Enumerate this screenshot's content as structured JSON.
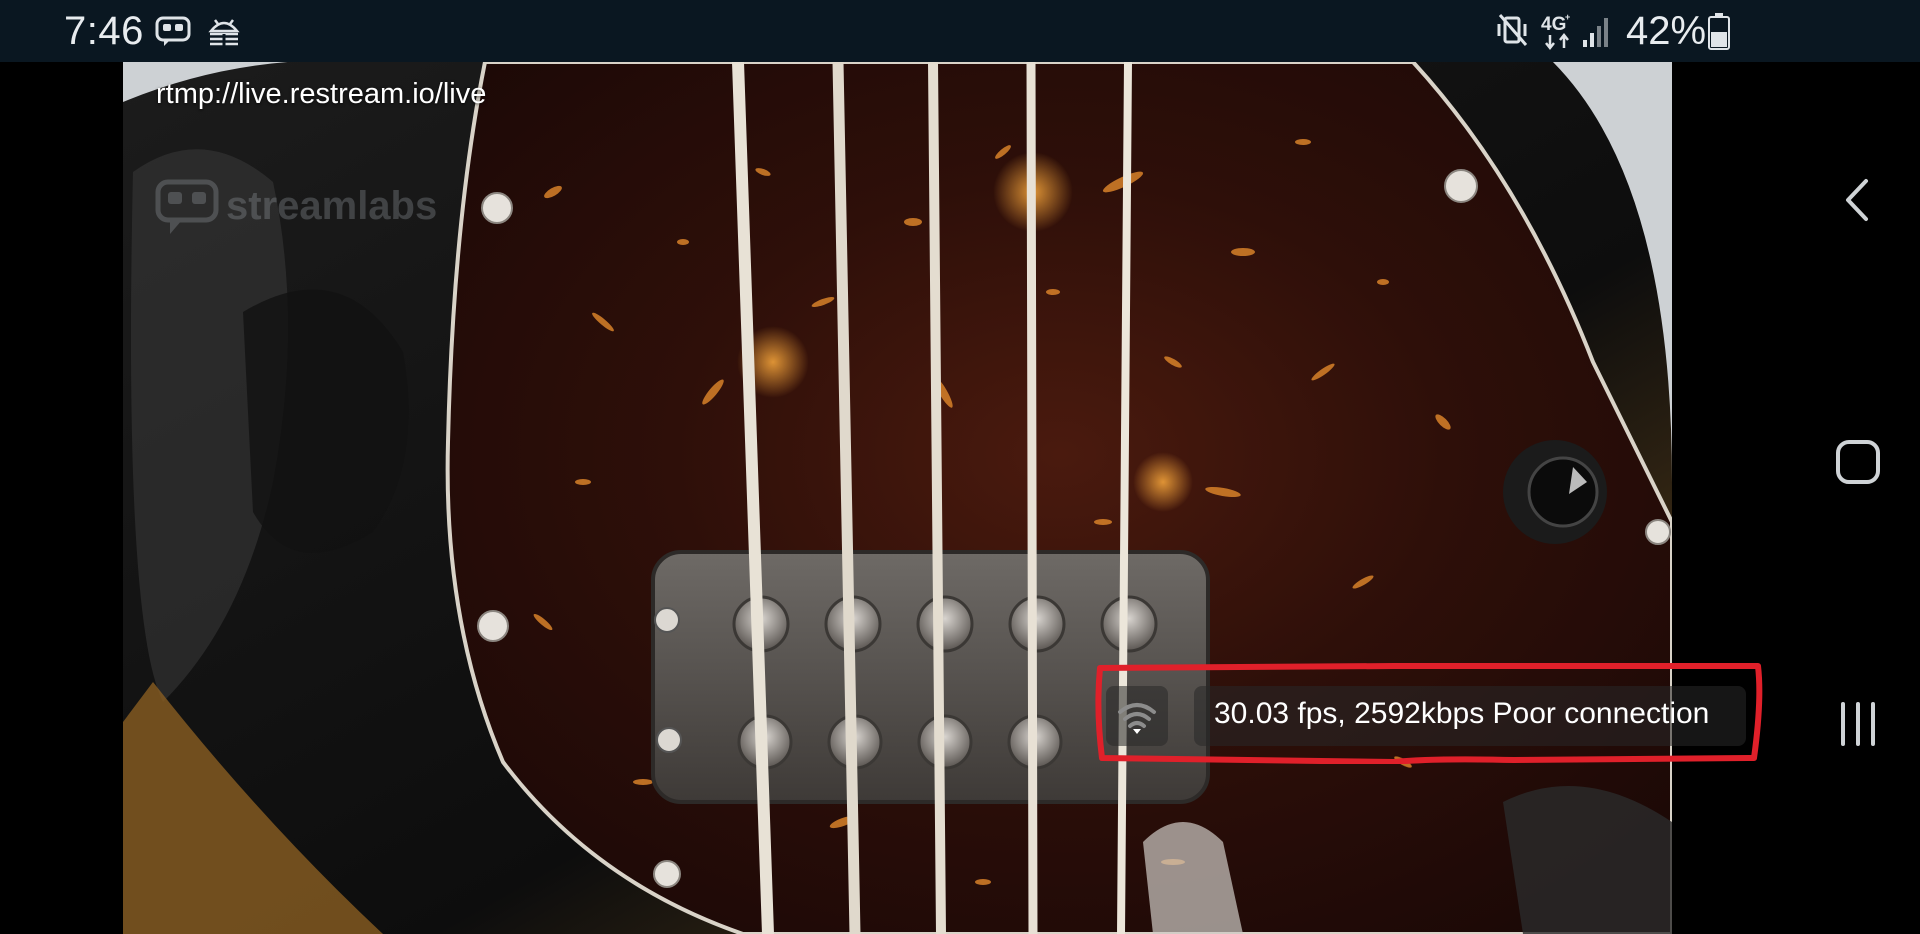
{
  "status_bar": {
    "time": "7:46",
    "app_icons": [
      "streamlabs-icon",
      "android-debug-icon"
    ],
    "system_icons": [
      "vibrate-mute-icon",
      "4g-network-icon",
      "cell-signal-icon"
    ],
    "battery": "42%",
    "battery_icon": "battery-icon"
  },
  "stream": {
    "rtmp_url": "rtmp://live.restream.io/live",
    "watermark_text": "streamlabs",
    "stats": "30.03 fps, 2592kbps Poor connection",
    "connection_icon": "wifi-weak-icon"
  },
  "annotation": {
    "highlight_color": "#e0202a"
  },
  "nav_bar": {
    "buttons": [
      "back-icon",
      "home-icon",
      "recents-icon"
    ]
  }
}
